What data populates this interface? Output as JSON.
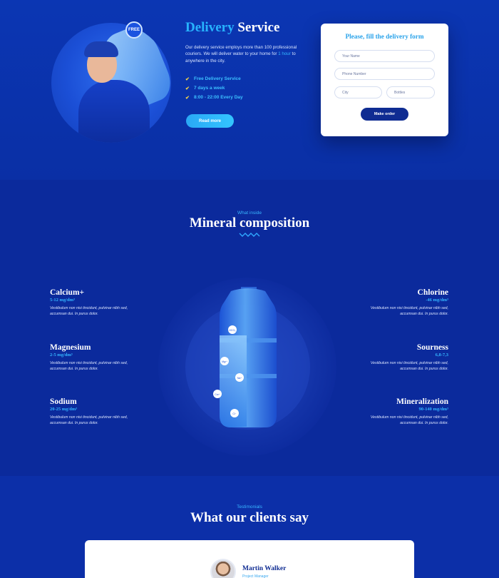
{
  "delivery": {
    "badge": "FREE",
    "title_accent": "Delivery",
    "title_rest": "Service",
    "desc_start": "Our delivery service employs more than 100 professional couriers. We will deliver water to your home for",
    "desc_highlight": "1 hour",
    "desc_end": "to anywhere in the city.",
    "features": [
      "Free Delivery Service",
      "7 days a week",
      "8:00 - 22:00 Every Day"
    ],
    "read_more": "Read more"
  },
  "form": {
    "title": "Please, fill the delivery form",
    "name_placeholder": "Your Name",
    "phone_placeholder": "Phone Number",
    "city_placeholder": "City",
    "bottles_placeholder": "Bottles",
    "submit": "Make order"
  },
  "composition": {
    "eyebrow": "What inside",
    "title": "Mineral composition",
    "bottle_labels": [
      "HCO₃",
      "Mg²⁺",
      "Na⁺",
      "Ca²⁺",
      "Cl⁻"
    ],
    "minerals_left": [
      {
        "name": "Calcium+",
        "value": "5-12 mg/dm³",
        "desc": "Vestibulum non nisi tincidunt, pulvinar nibh sed, accumsan dui. In purus dolor."
      },
      {
        "name": "Magnesium",
        "value": "2-5 mg/dm³",
        "desc": "Vestibulum non nisi tincidunt, pulvinar nibh sed, accumsan dui. In purus dolor."
      },
      {
        "name": "Sodium",
        "value": "20-25 mg/dm³",
        "desc": "Vestibulum non nisi tincidunt, pulvinar nibh sed, accumsan dui. In purus dolor."
      }
    ],
    "minerals_right": [
      {
        "name": "Chlorine",
        "value": "-46 mg/dm³",
        "desc": "Vestibulum non nisi tincidunt, pulvinar nibh sed, accumsan dui. In purus dolor."
      },
      {
        "name": "Sourness",
        "value": "6,8-7,3",
        "desc": "Vestibulum non nisi tincidunt, pulvinar nibh sed, accumsan dui. In purus dolor."
      },
      {
        "name": "Mineralization",
        "value": "90-140 mg/dm³",
        "desc": "Vestibulum non nisi tincidunt, pulvinar nibh sed, accumsan dui. In purus dolor."
      }
    ]
  },
  "testimonials": {
    "eyebrow": "Testimonials",
    "title": "What our clients say",
    "name": "Martin Walker",
    "role": "Project Manager"
  },
  "colors": {
    "background": "#0b2a9c",
    "accent": "#27b3ff",
    "button_dark": "#0f2c92",
    "check": "#f1d34a"
  }
}
